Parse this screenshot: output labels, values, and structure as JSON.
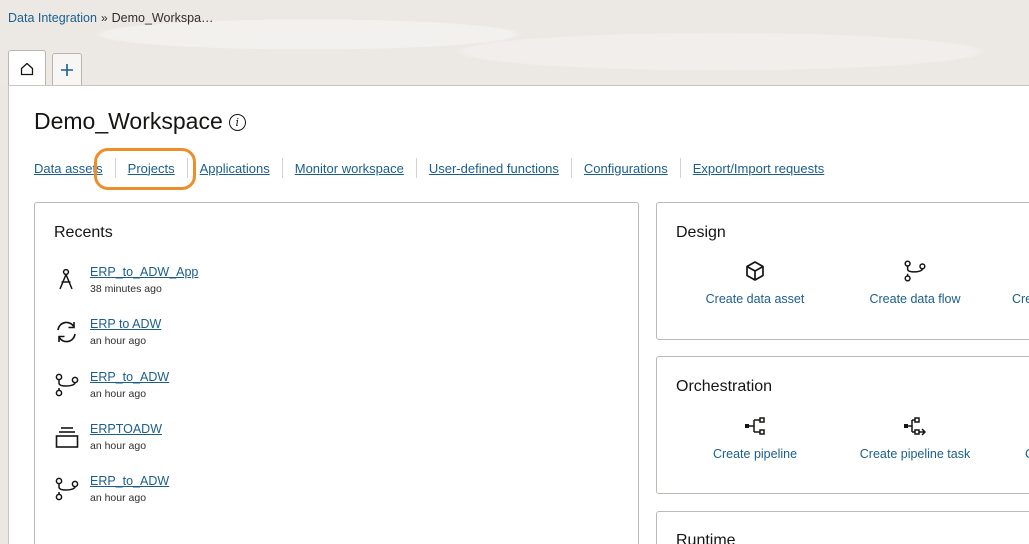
{
  "breadcrumb": {
    "root": "Data Integration",
    "separator": "»",
    "current": "Demo_Workspa…"
  },
  "tabs": [
    {
      "icon": "home-icon"
    },
    {
      "icon": "plus-icon"
    }
  ],
  "page": {
    "title": "Demo_Workspace"
  },
  "nav": {
    "items": [
      "Data assets",
      "Projects",
      "Applications",
      "Monitor workspace",
      "User-defined functions",
      "Configurations",
      "Export/Import requests"
    ]
  },
  "recents": {
    "title": "Recents",
    "items": [
      {
        "icon": "application-icon",
        "name": "ERP_to_ADW_App",
        "time": "38 minutes ago"
      },
      {
        "icon": "sync-icon",
        "name": "ERP to ADW",
        "time": "an hour ago"
      },
      {
        "icon": "data-flow-icon",
        "name": "ERP_to_ADW",
        "time": "an hour ago"
      },
      {
        "icon": "folder-stack-icon",
        "name": "ERPTOADW",
        "time": "an hour ago"
      },
      {
        "icon": "data-flow-icon",
        "name": "ERP_to_ADW",
        "time": "an hour ago"
      }
    ]
  },
  "design": {
    "title": "Design",
    "actions": [
      {
        "icon": "cube-icon",
        "label": "Create data asset"
      },
      {
        "icon": "data-flow-icon",
        "label": "Create data flow"
      },
      {
        "icon": "",
        "label": "Cre"
      }
    ]
  },
  "orchestration": {
    "title": "Orchestration",
    "actions": [
      {
        "icon": "pipeline-icon",
        "label": "Create pipeline"
      },
      {
        "icon": "pipeline-task-icon",
        "label": "Create pipeline task"
      },
      {
        "icon": "",
        "label": "C"
      }
    ]
  },
  "runtime": {
    "title": "Runtime"
  },
  "colors": {
    "link": "#1b5e8c",
    "highlight": "#ec8f2b",
    "border": "#bcb8b3"
  }
}
